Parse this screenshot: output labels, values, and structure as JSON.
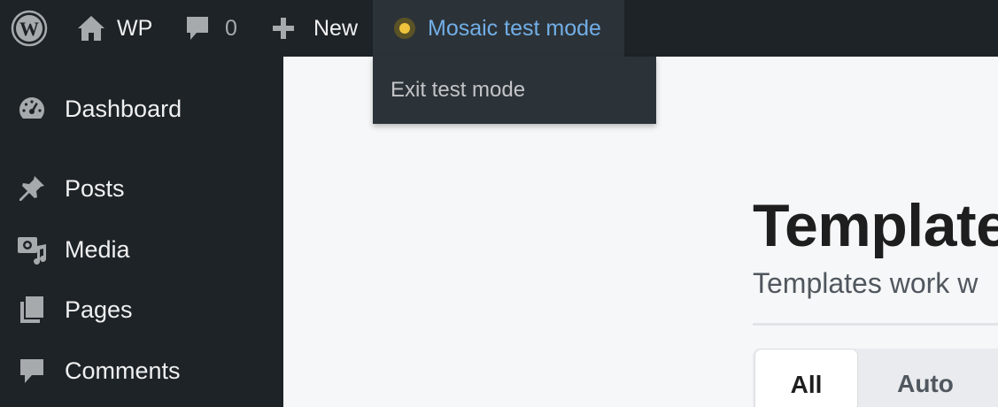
{
  "admin_bar": {
    "site_name": "WP",
    "comments_count": "0",
    "new_label": "New",
    "mosaic_label": "Mosaic test mode",
    "mosaic_dropdown": {
      "exit_label": "Exit test mode"
    }
  },
  "sidebar": {
    "items": [
      {
        "label": "Dashboard",
        "icon": "dashboard-icon"
      },
      {
        "label": "Posts",
        "icon": "pin-icon"
      },
      {
        "label": "Media",
        "icon": "media-icon"
      },
      {
        "label": "Pages",
        "icon": "pages-icon"
      },
      {
        "label": "Comments",
        "icon": "comment-icon"
      }
    ]
  },
  "main": {
    "title": "Templates",
    "subtitle": "Templates work w",
    "tabs": [
      {
        "label": "All",
        "active": true
      },
      {
        "label": "Auto",
        "active": false
      }
    ]
  },
  "colors": {
    "admin_bar_bg": "#1d2327",
    "highlight_bg": "#2c3338",
    "link_blue": "#72aee6",
    "status_dot": "#f0c33c"
  }
}
